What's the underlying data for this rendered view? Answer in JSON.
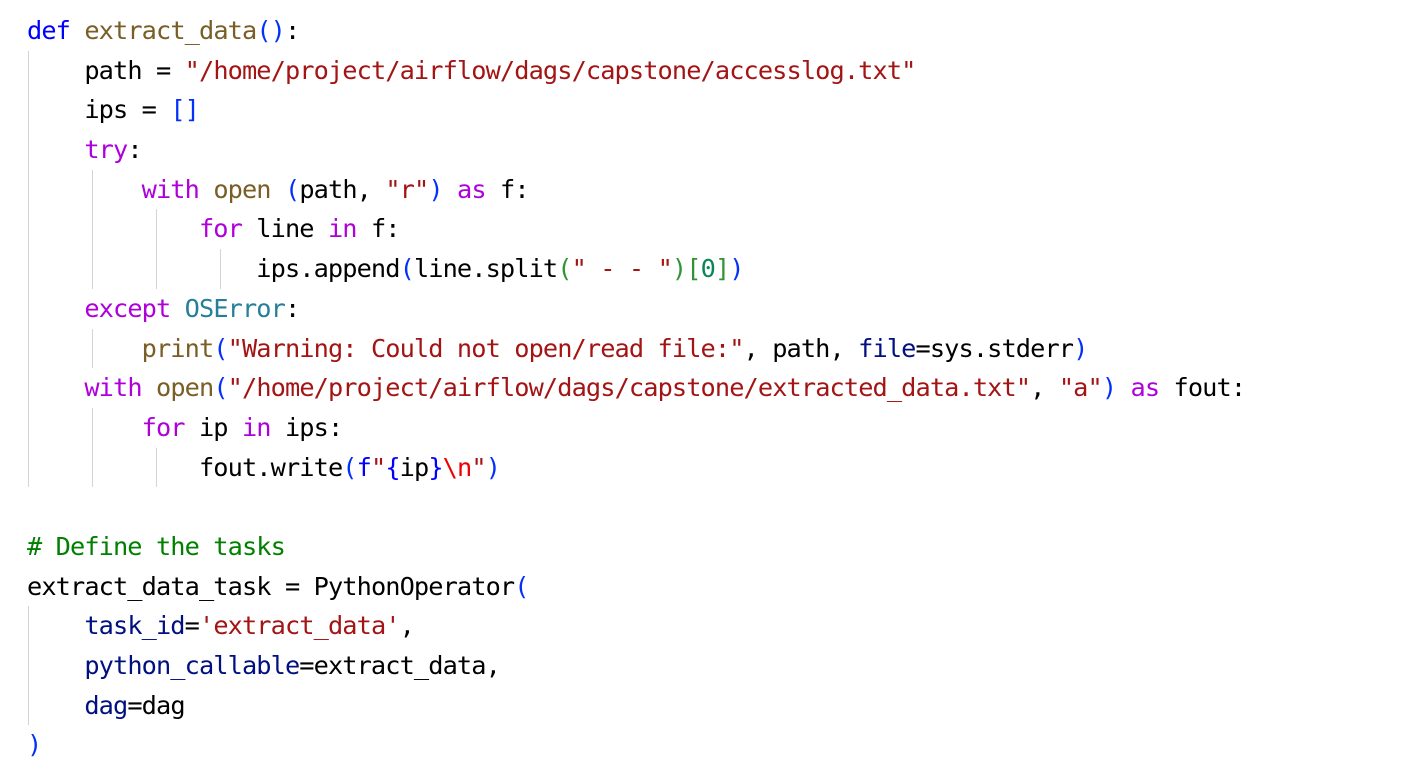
{
  "code_lines": [
    {
      "indent": 0,
      "tokens": [
        {
          "t": "def",
          "c": "kw-blue"
        },
        {
          "t": " ",
          "c": "plain"
        },
        {
          "t": "extract_data",
          "c": "fn"
        },
        {
          "t": "()",
          "c": "brk1"
        },
        {
          "t": ":",
          "c": "plain"
        }
      ]
    },
    {
      "indent": 1,
      "tokens": [
        {
          "t": "path",
          "c": "plain"
        },
        {
          "t": " = ",
          "c": "plain"
        },
        {
          "t": "\"/home/project/airflow/dags/capstone/accesslog.txt\"",
          "c": "str"
        }
      ]
    },
    {
      "indent": 1,
      "tokens": [
        {
          "t": "ips",
          "c": "plain"
        },
        {
          "t": " = ",
          "c": "plain"
        },
        {
          "t": "[]",
          "c": "brk1"
        }
      ]
    },
    {
      "indent": 1,
      "tokens": [
        {
          "t": "try",
          "c": "kw-purple"
        },
        {
          "t": ":",
          "c": "plain"
        }
      ]
    },
    {
      "indent": 2,
      "tokens": [
        {
          "t": "with",
          "c": "kw-purple"
        },
        {
          "t": " ",
          "c": "plain"
        },
        {
          "t": "open",
          "c": "fn"
        },
        {
          "t": " ",
          "c": "plain"
        },
        {
          "t": "(",
          "c": "brk1"
        },
        {
          "t": "path, ",
          "c": "plain"
        },
        {
          "t": "\"r\"",
          "c": "str"
        },
        {
          "t": ")",
          "c": "brk1"
        },
        {
          "t": " ",
          "c": "plain"
        },
        {
          "t": "as",
          "c": "kw-purple"
        },
        {
          "t": " f:",
          "c": "plain"
        }
      ]
    },
    {
      "indent": 3,
      "tokens": [
        {
          "t": "for",
          "c": "kw-purple"
        },
        {
          "t": " line ",
          "c": "plain"
        },
        {
          "t": "in",
          "c": "kw-purple"
        },
        {
          "t": " f:",
          "c": "plain"
        }
      ]
    },
    {
      "indent": 4,
      "tokens": [
        {
          "t": "ips.append",
          "c": "plain"
        },
        {
          "t": "(",
          "c": "brk1"
        },
        {
          "t": "line.split",
          "c": "plain"
        },
        {
          "t": "(",
          "c": "brk2"
        },
        {
          "t": "\" - - \"",
          "c": "str"
        },
        {
          "t": ")",
          "c": "brk2"
        },
        {
          "t": "[",
          "c": "brk2"
        },
        {
          "t": "0",
          "c": "num"
        },
        {
          "t": "]",
          "c": "brk2"
        },
        {
          "t": ")",
          "c": "brk1"
        }
      ]
    },
    {
      "indent": 1,
      "tokens": [
        {
          "t": "except",
          "c": "kw-purple"
        },
        {
          "t": " ",
          "c": "plain"
        },
        {
          "t": "OSError",
          "c": "cls"
        },
        {
          "t": ":",
          "c": "plain"
        }
      ]
    },
    {
      "indent": 2,
      "tokens": [
        {
          "t": "print",
          "c": "fn"
        },
        {
          "t": "(",
          "c": "brk1"
        },
        {
          "t": "\"Warning: Could not open/read file:\"",
          "c": "str"
        },
        {
          "t": ", path, ",
          "c": "plain"
        },
        {
          "t": "file",
          "c": "param"
        },
        {
          "t": "=sys.stderr",
          "c": "plain"
        },
        {
          "t": ")",
          "c": "brk1"
        }
      ]
    },
    {
      "indent": 1,
      "tokens": [
        {
          "t": "with",
          "c": "kw-purple"
        },
        {
          "t": " ",
          "c": "plain"
        },
        {
          "t": "open",
          "c": "fn"
        },
        {
          "t": "(",
          "c": "brk1"
        },
        {
          "t": "\"/home/project/airflow/dags/capstone/extracted_data.txt\"",
          "c": "str"
        },
        {
          "t": ", ",
          "c": "plain"
        },
        {
          "t": "\"a\"",
          "c": "str"
        },
        {
          "t": ")",
          "c": "brk1"
        },
        {
          "t": " ",
          "c": "plain"
        },
        {
          "t": "as",
          "c": "kw-purple"
        },
        {
          "t": " fout:",
          "c": "plain"
        }
      ]
    },
    {
      "indent": 2,
      "tokens": [
        {
          "t": "for",
          "c": "kw-purple"
        },
        {
          "t": " ip ",
          "c": "plain"
        },
        {
          "t": "in",
          "c": "kw-purple"
        },
        {
          "t": " ips:",
          "c": "plain"
        }
      ]
    },
    {
      "indent": 3,
      "tokens": [
        {
          "t": "fout.write",
          "c": "plain"
        },
        {
          "t": "(",
          "c": "brk1"
        },
        {
          "t": "f",
          "c": "kw-blue"
        },
        {
          "t": "\"",
          "c": "str"
        },
        {
          "t": "{",
          "c": "kw-blue"
        },
        {
          "t": "ip",
          "c": "plain"
        },
        {
          "t": "}",
          "c": "kw-blue"
        },
        {
          "t": "\\n",
          "c": "esc"
        },
        {
          "t": "\"",
          "c": "str"
        },
        {
          "t": ")",
          "c": "brk1"
        }
      ]
    },
    {
      "indent": 0,
      "tokens": []
    },
    {
      "indent": 0,
      "tokens": [
        {
          "t": "# Define the tasks",
          "c": "cmt"
        }
      ]
    },
    {
      "indent": 0,
      "tokens": [
        {
          "t": "extract_data_task",
          "c": "plain"
        },
        {
          "t": " = ",
          "c": "plain"
        },
        {
          "t": "PythonOperator",
          "c": "plain"
        },
        {
          "t": "(",
          "c": "brk1"
        }
      ]
    },
    {
      "indent": 1,
      "tokens": [
        {
          "t": "task_id",
          "c": "param"
        },
        {
          "t": "=",
          "c": "plain"
        },
        {
          "t": "'extract_data'",
          "c": "str"
        },
        {
          "t": ",",
          "c": "plain"
        }
      ]
    },
    {
      "indent": 1,
      "tokens": [
        {
          "t": "python_callable",
          "c": "param"
        },
        {
          "t": "=extract_data,",
          "c": "plain"
        }
      ]
    },
    {
      "indent": 1,
      "tokens": [
        {
          "t": "dag",
          "c": "param"
        },
        {
          "t": "=dag",
          "c": "plain"
        }
      ]
    },
    {
      "indent": 0,
      "tokens": [
        {
          "t": ")",
          "c": "brk1"
        }
      ]
    }
  ]
}
